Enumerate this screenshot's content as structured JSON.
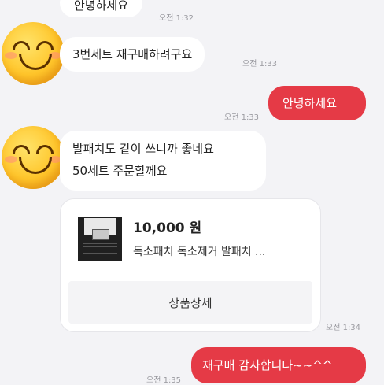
{
  "messages": [
    {
      "text": "안녕하세요",
      "time": "오전 1:32"
    },
    {
      "text": "3번세트 재구매하려구요",
      "time": "오전 1:33"
    },
    {
      "text": "안녕하세요",
      "time": "오전 1:33"
    },
    {
      "line1": "발패치도 같이 쓰니까 좋네요",
      "line2": "50세트 주문할께요"
    },
    {
      "text": "재구매 감사합니다~~^^",
      "time": "오전 1:35"
    }
  ],
  "product_card": {
    "price": "10,000 원",
    "name": "독소패치 독소제거 발패치 ...",
    "detail_button": "상품상세",
    "time": "오전 1:34"
  },
  "colors": {
    "outgoing_bubble": "#e53a46",
    "incoming_bubble": "#ffffff",
    "background": "#f3f3f6"
  }
}
